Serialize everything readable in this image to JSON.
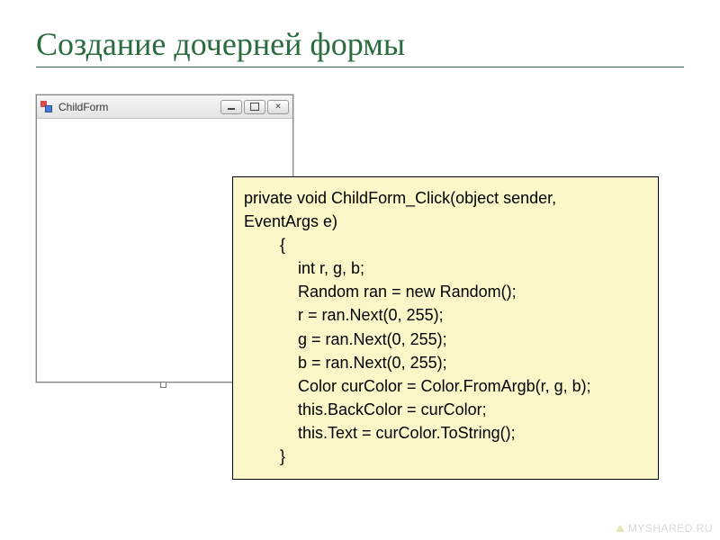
{
  "slide": {
    "title": "Создание дочерней формы"
  },
  "window": {
    "title": "ChildForm"
  },
  "code": {
    "text": "private void ChildForm_Click(object sender,\nEventArgs e)\n        {\n            int r, g, b;\n            Random ran = new Random();\n            r = ran.Next(0, 255);\n            g = ran.Next(0, 255);\n            b = ran.Next(0, 255);\n            Color curColor = Color.FromArgb(r, g, b);\n            this.BackColor = curColor;\n            this.Text = curColor.ToString();\n        }"
  },
  "watermark": {
    "text": "MYSHARED.RU"
  }
}
